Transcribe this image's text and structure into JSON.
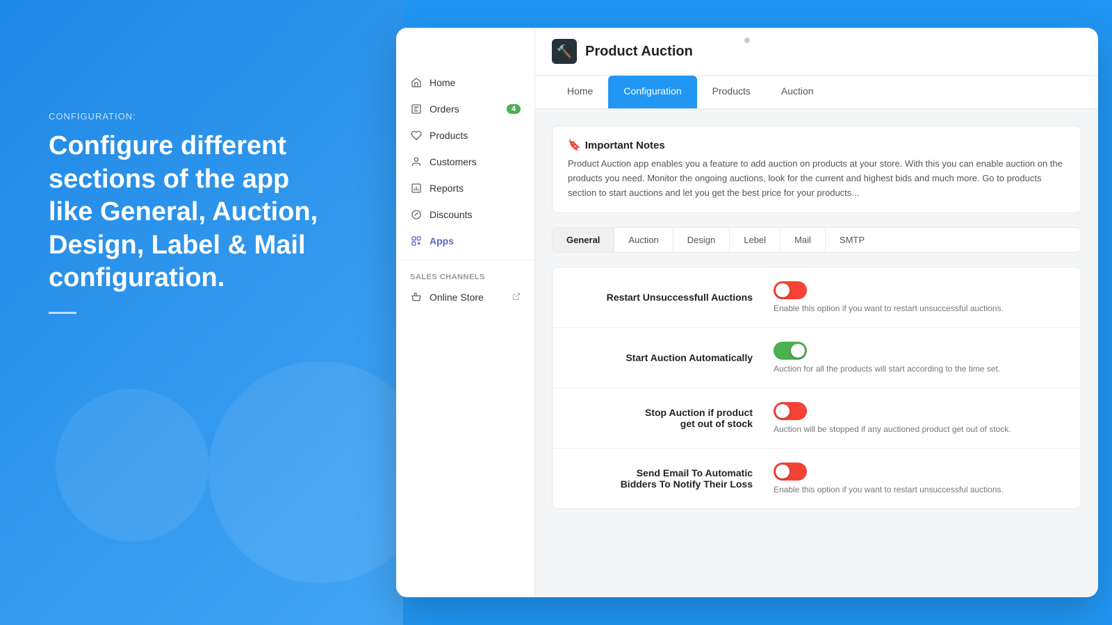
{
  "left": {
    "label": "CONFIGURATION:",
    "heading": "Configure different sections of the app like General, Auction, Design, Label & Mail configuration."
  },
  "window": {
    "dot_color": "#ccc"
  },
  "sidebar": {
    "items": [
      {
        "id": "home",
        "label": "Home",
        "icon": "home-icon",
        "badge": null,
        "external": false
      },
      {
        "id": "orders",
        "label": "Orders",
        "icon": "orders-icon",
        "badge": "4",
        "external": false
      },
      {
        "id": "products",
        "label": "Products",
        "icon": "products-icon",
        "badge": null,
        "external": false
      },
      {
        "id": "customers",
        "label": "Customers",
        "icon": "customers-icon",
        "badge": null,
        "external": false
      },
      {
        "id": "reports",
        "label": "Reports",
        "icon": "reports-icon",
        "badge": null,
        "external": false
      },
      {
        "id": "discounts",
        "label": "Discounts",
        "icon": "discounts-icon",
        "badge": null,
        "external": false
      },
      {
        "id": "apps",
        "label": "Apps",
        "icon": "apps-icon",
        "badge": null,
        "external": false,
        "active": true
      }
    ],
    "sales_channels_label": "SALES CHANNELS",
    "sales_channels": [
      {
        "id": "online-store",
        "label": "Online Store",
        "icon": "store-icon",
        "external": true
      }
    ]
  },
  "header": {
    "icon": "🔨",
    "title": "Product Auction"
  },
  "nav_tabs": [
    {
      "id": "home",
      "label": "Home",
      "active": false
    },
    {
      "id": "configuration",
      "label": "Configuration",
      "active": true
    },
    {
      "id": "products",
      "label": "Products",
      "active": false
    },
    {
      "id": "auction",
      "label": "Auction",
      "active": false
    }
  ],
  "notes": {
    "title": "Important Notes",
    "icon": "🔖",
    "text": "Product Auction app enables you a feature to add auction on products at your store. With this you can enable auction on the products you need. Monitor the ongoing auctions, look for the current and highest bids and much more. Go to products section to start auctions and let you get the best price for your products..."
  },
  "sub_tabs": [
    {
      "id": "general",
      "label": "General",
      "active": true
    },
    {
      "id": "auction",
      "label": "Auction",
      "active": false
    },
    {
      "id": "design",
      "label": "Design",
      "active": false
    },
    {
      "id": "lebel",
      "label": "Lebel",
      "active": false
    },
    {
      "id": "mail",
      "label": "Mail",
      "active": false
    },
    {
      "id": "smtp",
      "label": "SMTP",
      "active": false
    }
  ],
  "settings": [
    {
      "id": "restart-unsuccessful",
      "title": "Restart Unsuccessfull Auctions",
      "subtitle": null,
      "enabled": false,
      "description": "Enable this option if you want to restart unsuccessful auctions."
    },
    {
      "id": "start-automatically",
      "title": "Start Auction Automatically",
      "subtitle": null,
      "enabled": true,
      "description": "Auction for all the products will start according to the time set."
    },
    {
      "id": "stop-out-of-stock",
      "title": "Stop Auction if product",
      "title2": "get out of stock",
      "subtitle": null,
      "enabled": false,
      "description": "Auction will be stopped if any auctioned product get out of stock."
    },
    {
      "id": "send-email-bidders",
      "title": "Send Email To Automatic",
      "title2": "Bidders To Notify Their Loss",
      "subtitle": null,
      "enabled": false,
      "description": "Enable this option if you want to restart unsuccessful auctions."
    }
  ],
  "colors": {
    "primary_blue": "#2196F3",
    "active_tab": "#2196F3",
    "toggle_on": "#4CAF50",
    "toggle_off": "#F44336"
  }
}
